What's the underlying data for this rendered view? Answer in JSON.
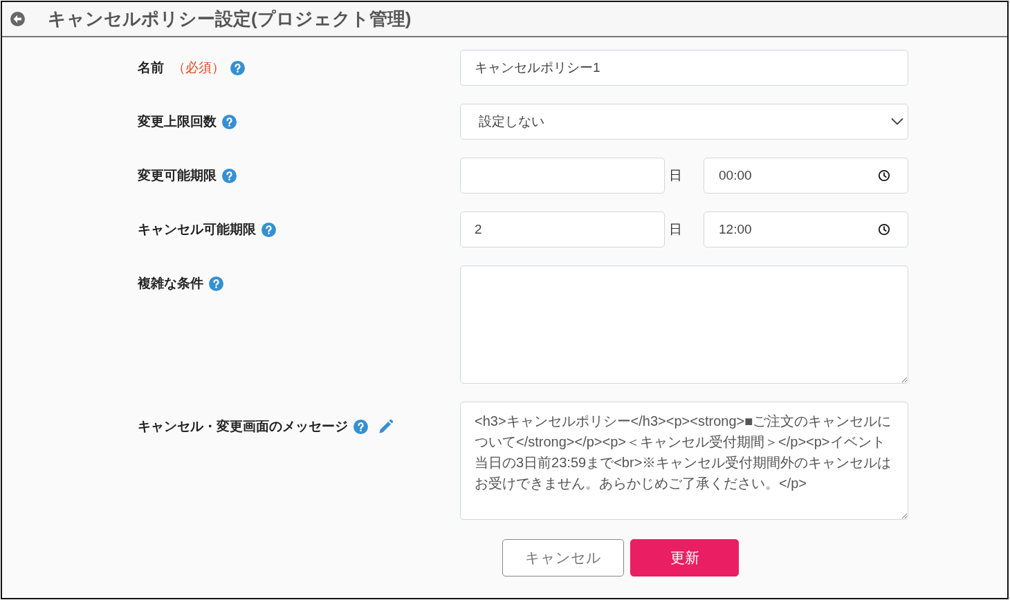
{
  "header": {
    "title": "キャンセルポリシー設定(プロジェクト管理)"
  },
  "form": {
    "fields": [
      {
        "kind": "text",
        "label": "名前",
        "required_note": "（必須）",
        "editor_icon": false,
        "value": "キャンセルポリシー1"
      },
      {
        "kind": "select",
        "label": "変更上限回数",
        "editor_icon": false,
        "value": "設定しない"
      },
      {
        "kind": "deadline",
        "label": "変更可能期限",
        "editor_icon": false,
        "day_unit": "日",
        "time": "00:00"
      },
      {
        "kind": "deadline",
        "label": "キャンセル可能期限",
        "editor_icon": false,
        "day": "2",
        "day_unit": "日",
        "time": "12:00"
      },
      {
        "kind": "textarea",
        "label": "複雑な条件",
        "editor_icon": false
      },
      {
        "kind": "textarea",
        "label": "キャンセル・変更画面のメッセージ",
        "editor_icon": true,
        "value": "<h3>キャンセルポリシー</h3><p><strong>■ご注文のキャンセルについて</strong></p><p>＜キャンセル受付期間＞</p><p>イベント当日の3日前23:59まで<br>※キャンセル受付期間外のキャンセルはお受けできません。あらかじめご了承ください。</p>"
      }
    ]
  },
  "buttons": [
    {
      "kind": "secondary",
      "label": "キャンセル"
    },
    {
      "kind": "primary",
      "label": "更新"
    }
  ]
}
